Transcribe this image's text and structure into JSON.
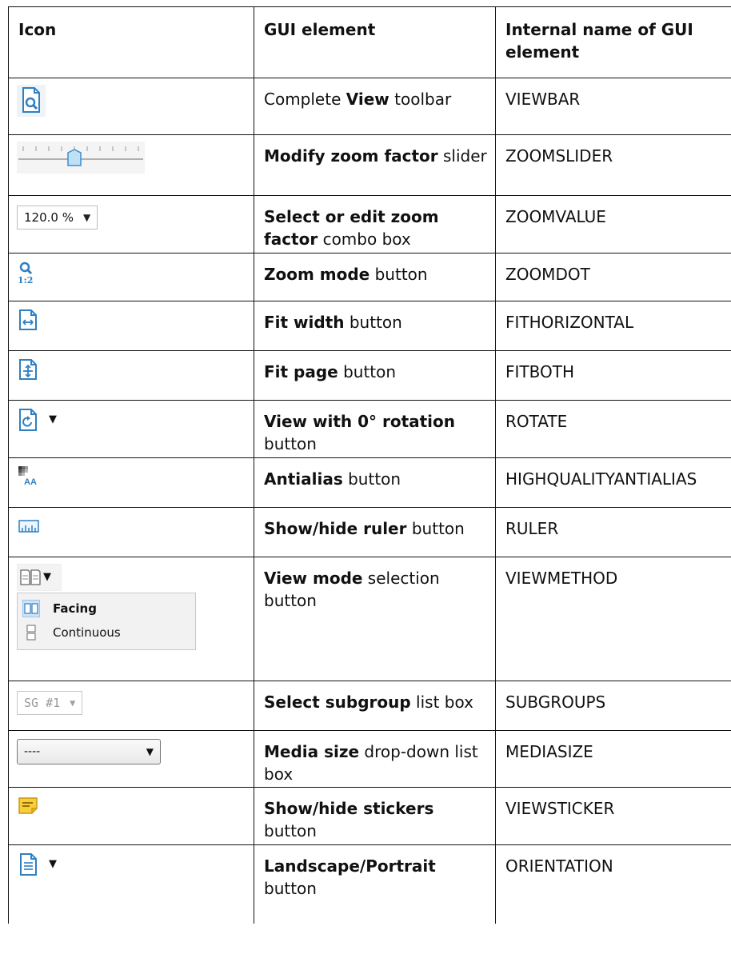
{
  "table": {
    "headers": {
      "icon": "Icon",
      "gui": "GUI element",
      "internal": "Internal name of GUI element"
    },
    "rows": [
      {
        "bold": "",
        "pre": "Complete ",
        "bold_mid": "View",
        "post": " toolbar",
        "internal": "VIEWBAR",
        "icon": "document-magnifier-icon"
      },
      {
        "bold": "Modify zoom factor",
        "post": " slider",
        "internal": "ZOOMSLIDER",
        "icon": "zoom-slider-icon",
        "slider_level": 0.42
      },
      {
        "bold": "Select or edit zoom factor",
        "post": " combo box",
        "internal": "ZOOMVALUE",
        "icon": "zoom-combo",
        "combo_value": "120.0 %"
      },
      {
        "bold": "Zoom mode",
        "post": " button",
        "internal": "ZOOMDOT",
        "icon": "zoom-ratio-icon",
        "icon_text": "1:2"
      },
      {
        "bold": "Fit width",
        "post": " button",
        "internal": "FITHORIZONTAL",
        "icon": "fit-width-icon"
      },
      {
        "bold": "Fit page",
        "post": " button",
        "internal": "FITBOTH",
        "icon": "fit-page-icon"
      },
      {
        "bold": "View with 0° rotation",
        "post": " button",
        "internal": "ROTATE",
        "icon": "rotate-page-icon"
      },
      {
        "bold": "Antialias",
        "post": " button",
        "internal": "HIGHQUALITYANTIALIAS",
        "icon": "antialias-icon",
        "icon_text": "AA"
      },
      {
        "bold": "Show/hide ruler",
        "post": " button",
        "internal": "RULER",
        "icon": "ruler-icon"
      },
      {
        "bold": "View mode",
        "post": " selection button",
        "internal": "VIEWMETHOD",
        "icon": "view-mode-menu",
        "menu": [
          "Facing",
          "Continuous"
        ]
      },
      {
        "bold": "Select subgroup",
        "post": " list box",
        "internal": "SUBGROUPS",
        "icon": "subgroup-combo",
        "combo_value": "SG #1"
      },
      {
        "bold": "Media size",
        "post": " drop-down list box",
        "internal": "MEDIASIZE",
        "icon": "media-size-dropdown",
        "combo_value": "----"
      },
      {
        "bold": "Show/hide stickers",
        "post": " button",
        "internal": "VIEWSTICKER",
        "icon": "sticker-note-icon"
      },
      {
        "bold": "Landscape/Portrait",
        "post": " button",
        "internal": "ORIENTATION",
        "icon": "page-orientation-icon"
      }
    ]
  },
  "colors": {
    "accent_blue": "#2f7fc1",
    "sticker_yellow": "#f2c12e",
    "border": "#111111"
  }
}
